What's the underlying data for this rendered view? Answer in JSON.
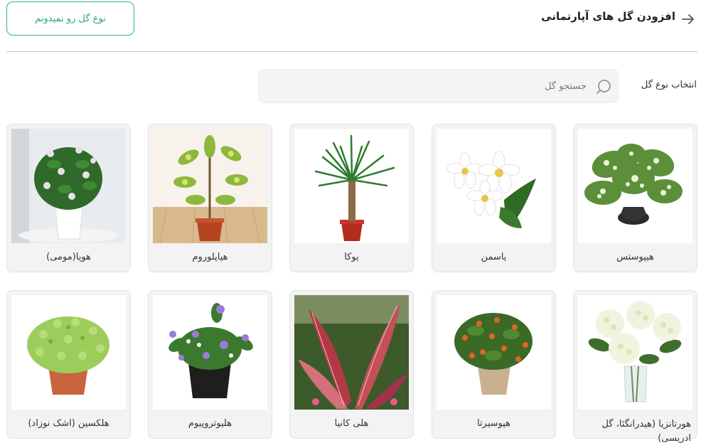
{
  "header": {
    "title": "افزودن گل های آپارتمانی",
    "unknown_button": "نوع گل رو نمیدونم"
  },
  "filter": {
    "label": "انتخاب نوع گل",
    "search_placeholder": "جستجو گل"
  },
  "plants": [
    {
      "name": "هیپوستس"
    },
    {
      "name": "یاسمن"
    },
    {
      "name": "یوکا"
    },
    {
      "name": "هپاپلوروم"
    },
    {
      "name": "هویا(مومی)"
    },
    {
      "name": "هورتانزیا (هیدرانگئا، گل ادریسی)"
    },
    {
      "name": "هپوسیرتا"
    },
    {
      "name": "هلی کانیا"
    },
    {
      "name": "هلیوتروپیوم"
    },
    {
      "name": "هلکسین (اشک نوزاد)"
    }
  ],
  "colors": {
    "accent": "#2bb673",
    "card_bg": "#f3f3f3",
    "search_bg": "#f4f4f4"
  }
}
